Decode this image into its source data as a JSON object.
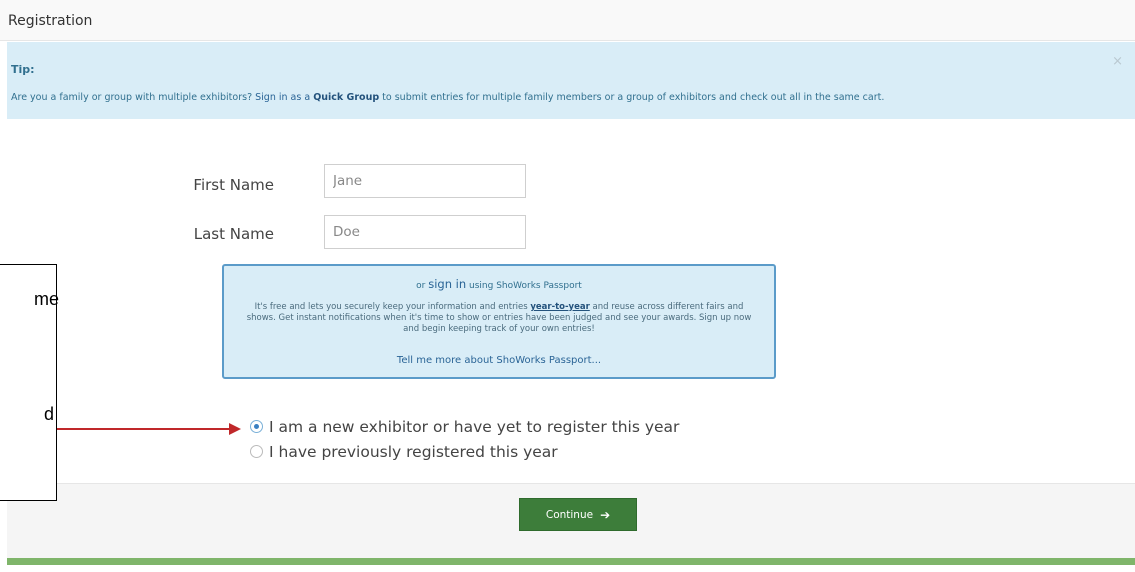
{
  "header": {
    "title": "Registration"
  },
  "tip": {
    "heading": "Tip:",
    "text_before": "Are you a family or group with multiple exhibitors? ",
    "link_text": "Sign in as a ",
    "link_bold": "Quick Group",
    "text_after": " to submit entries for multiple family members or a group of exhibitors and check out all in the same cart.",
    "close_icon": "×"
  },
  "form": {
    "first_name_label": "First Name",
    "first_name_value": "Jane",
    "last_name_label": "Last Name",
    "last_name_value": "Doe"
  },
  "passport": {
    "or_text": "or ",
    "signin_text": "sign in",
    "using_text": " using ShoWorks Passport",
    "body_before": "It's free and lets you securely keep your information and entries ",
    "body_link": "year-to-year",
    "body_after": " and reuse across different fairs and shows. Get instant notifications when it's time to show or entries have been judged and see your awards. Sign up now and begin keeping track of your own entries!",
    "more_link": "Tell me more about ShoWorks Passport..."
  },
  "options": [
    {
      "label": "I am a new exhibitor or have yet to register this year",
      "checked": true
    },
    {
      "label": "I have previously registered this year",
      "checked": false
    }
  ],
  "continue_button": {
    "label": "Continue",
    "icon": "➔"
  },
  "annotation": {
    "text_1": "me",
    "text_2": "d"
  },
  "colors": {
    "tip_bg": "#d9edf7",
    "button_green": "#3d7d3a",
    "arrow_red": "#c0282a"
  }
}
